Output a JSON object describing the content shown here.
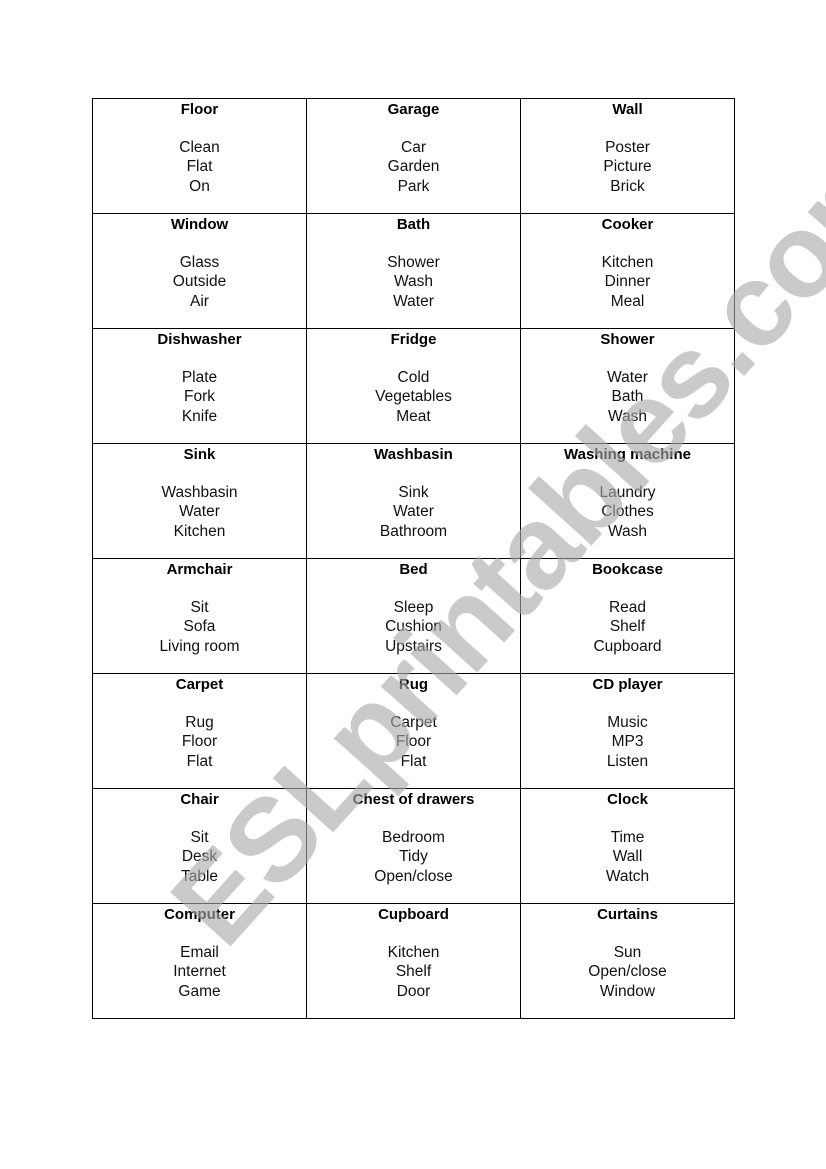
{
  "cards": [
    {
      "title": "Floor",
      "words": [
        "Clean",
        "Flat",
        "On"
      ]
    },
    {
      "title": "Garage",
      "words": [
        "Car",
        "Garden",
        "Park"
      ]
    },
    {
      "title": "Wall",
      "words": [
        "Poster",
        "Picture",
        "Brick"
      ]
    },
    {
      "title": "Window",
      "words": [
        "Glass",
        "Outside",
        "Air"
      ]
    },
    {
      "title": "Bath",
      "words": [
        "Shower",
        "Wash",
        "Water"
      ]
    },
    {
      "title": "Cooker",
      "words": [
        "Kitchen",
        "Dinner",
        "Meal"
      ]
    },
    {
      "title": "Dishwasher",
      "words": [
        "Plate",
        "Fork",
        "Knife"
      ]
    },
    {
      "title": "Fridge",
      "words": [
        "Cold",
        "Vegetables",
        "Meat"
      ]
    },
    {
      "title": "Shower",
      "words": [
        "Water",
        "Bath",
        "Wash"
      ]
    },
    {
      "title": "Sink",
      "words": [
        "Washbasin",
        "Water",
        "Kitchen"
      ]
    },
    {
      "title": "Washbasin",
      "words": [
        "Sink",
        "Water",
        "Bathroom"
      ]
    },
    {
      "title": "Washing machine",
      "words": [
        "Laundry",
        "Clothes",
        "Wash"
      ]
    },
    {
      "title": "Armchair",
      "words": [
        "Sit",
        "Sofa",
        "Living room"
      ]
    },
    {
      "title": "Bed",
      "words": [
        "Sleep",
        "Cushion",
        "Upstairs"
      ]
    },
    {
      "title": "Bookcase",
      "words": [
        "Read",
        "Shelf",
        "Cupboard"
      ]
    },
    {
      "title": "Carpet",
      "words": [
        "Rug",
        "Floor",
        "Flat"
      ]
    },
    {
      "title": "Rug",
      "words": [
        "Carpet",
        "Floor",
        "Flat"
      ]
    },
    {
      "title": "CD player",
      "words": [
        "Music",
        "MP3",
        "Listen"
      ]
    },
    {
      "title": "Chair",
      "words": [
        "Sit",
        "Desk",
        "Table"
      ]
    },
    {
      "title": "Chest of drawers",
      "words": [
        "Bedroom",
        "Tidy",
        "Open/close"
      ]
    },
    {
      "title": "Clock",
      "words": [
        "Time",
        "Wall",
        "Watch"
      ]
    },
    {
      "title": "Computer",
      "words": [
        "Email",
        "Internet",
        "Game"
      ]
    },
    {
      "title": "Cupboard",
      "words": [
        "Kitchen",
        "Shelf",
        "Door"
      ]
    },
    {
      "title": "Curtains",
      "words": [
        "Sun",
        "Open/close",
        "Window"
      ]
    }
  ],
  "watermark": "ESLprintables.com"
}
